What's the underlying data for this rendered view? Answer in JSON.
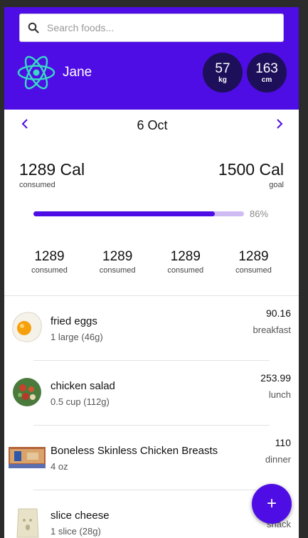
{
  "search": {
    "placeholder": "Search foods..."
  },
  "profile": {
    "name": "Jane"
  },
  "stats": [
    {
      "value": "57",
      "unit": "kg"
    },
    {
      "value": "163",
      "unit": "cm"
    }
  ],
  "date": {
    "label": "6 Oct",
    "prev_icon": "chevron-left-icon",
    "next_icon": "chevron-right-icon"
  },
  "summary": {
    "consumed_value": "1289 Cal",
    "consumed_label": "consumed",
    "goal_value": "1500 Cal",
    "goal_label": "goal",
    "progress_percent_text": "86%",
    "progress_fraction": 0.86
  },
  "macros": [
    {
      "value": "1289",
      "label": "consumed"
    },
    {
      "value": "1289",
      "label": "consumed"
    },
    {
      "value": "1289",
      "label": "consumed"
    },
    {
      "value": "1289",
      "label": "consumed"
    }
  ],
  "foods": [
    {
      "name": "fried eggs",
      "serving": "1 large (46g)",
      "calories": "90.16",
      "meal": "breakfast",
      "image": "fried-egg-image"
    },
    {
      "name": "chicken salad",
      "serving": "0.5 cup (112g)",
      "calories": "253.99",
      "meal": "lunch",
      "image": "chicken-salad-image"
    },
    {
      "name": "Boneless Skinless Chicken Breasts",
      "serving": "4 oz",
      "calories": "110",
      "meal": "dinner",
      "image": "chicken-package-image"
    },
    {
      "name": "slice cheese",
      "serving": "1 slice (28g)",
      "calories": "",
      "meal": "snack",
      "image": "cheese-slice-image"
    }
  ],
  "fab": {
    "label": "+"
  },
  "colors": {
    "primary": "#4e0de4",
    "stat_circle": "#1e0f5a",
    "progress_track": "#cfbcf5",
    "logo": "#38d9c6"
  }
}
